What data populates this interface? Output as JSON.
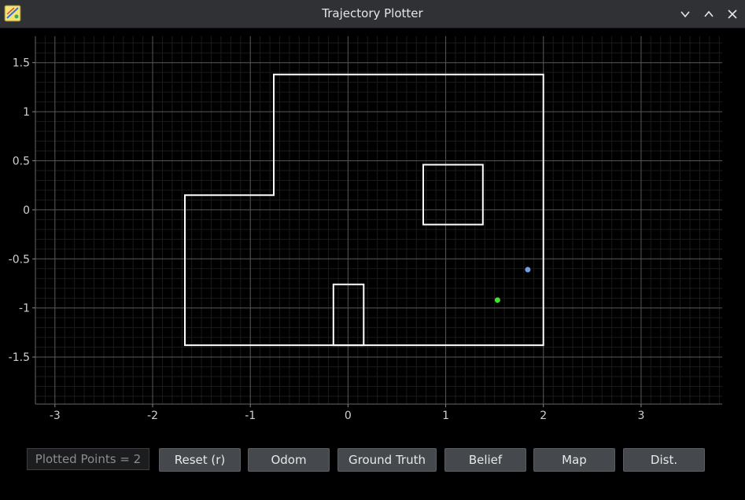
{
  "window": {
    "title": "Trajectory Plotter",
    "icons": [
      "app-icon",
      "minimize-icon",
      "maximize-icon"
    ]
  },
  "plot": {
    "x_ticks": [
      -3,
      -2,
      -1,
      0,
      1,
      2,
      3
    ],
    "y_ticks": [
      1.5,
      1,
      0.5,
      0,
      -0.5,
      -1,
      -1.5
    ],
    "xlim": [
      -3.2,
      3.83
    ],
    "ylim": [
      -1.98,
      1.77
    ],
    "grid": true,
    "grid_minor_step": 0.1,
    "colors": {
      "background": "#000000",
      "grid_minor": "#1b1b1b",
      "grid_major": "#555555",
      "map": "#ffffff",
      "ground_truth": "#3ee62a",
      "odom": "#6f9de6"
    },
    "map_polygons": [
      [
        [
          -1.67,
          0.15
        ],
        [
          -0.76,
          0.15
        ],
        [
          -0.76,
          1.38
        ],
        [
          2.0,
          1.38
        ],
        [
          2.0,
          -1.38
        ],
        [
          -1.67,
          -1.38
        ]
      ],
      [
        [
          0.77,
          0.46
        ],
        [
          1.38,
          0.46
        ],
        [
          1.38,
          -0.15
        ],
        [
          0.77,
          -0.15
        ]
      ],
      [
        [
          -0.15,
          -0.76
        ],
        [
          0.16,
          -0.76
        ],
        [
          0.16,
          -1.38
        ],
        [
          -0.15,
          -1.38
        ]
      ]
    ],
    "points": [
      {
        "name": "odom",
        "x": 1.84,
        "y": -0.61
      },
      {
        "name": "ground-truth",
        "x": 1.53,
        "y": -0.92
      }
    ]
  },
  "controls": {
    "counter": "Plotted Points = 2",
    "buttons": [
      "Reset (r)",
      "Odom",
      "Ground Truth",
      "Belief",
      "Map",
      "Dist."
    ]
  }
}
